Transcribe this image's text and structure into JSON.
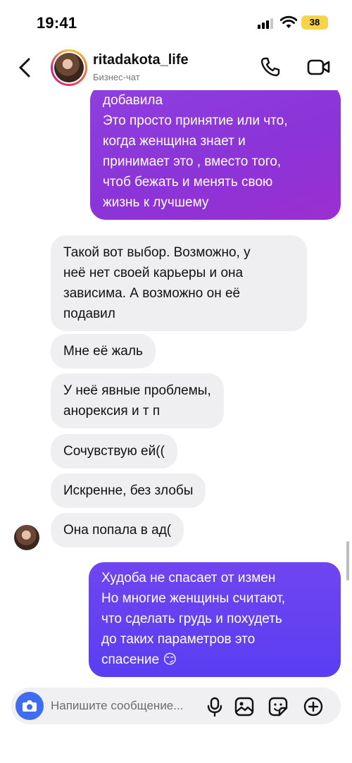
{
  "status_bar": {
    "time": "19:41",
    "battery": "38"
  },
  "header": {
    "username": "ritadakota_life",
    "subtitle": "Бизнес-чат"
  },
  "messages": [
    {
      "direction": "outgoing",
      "lines": [
        "добавила",
        "Это просто принятие или что,",
        "когда женщина знает и",
        "принимает это , вместо того,",
        "чтоб бежать и менять свою",
        "жизнь к лучшему"
      ]
    },
    {
      "direction": "incoming",
      "lines": [
        "Такой вот выбор. Возможно, у",
        "неё нет своей карьеры и она",
        "зависима. А возможно он её",
        "подавил"
      ]
    },
    {
      "direction": "incoming",
      "lines": [
        "Мне её жаль"
      ]
    },
    {
      "direction": "incoming",
      "lines": [
        "У неё явные проблемы,",
        "анорексия и т п"
      ]
    },
    {
      "direction": "incoming",
      "lines": [
        "Сочувствую ей(("
      ]
    },
    {
      "direction": "incoming",
      "lines": [
        "Искренне, без злобы"
      ]
    },
    {
      "direction": "incoming",
      "lines": [
        "Она попала в ад("
      ]
    },
    {
      "direction": "outgoing",
      "lines": [
        "Худоба не спасает от измен",
        "Но многие женщины считают,",
        "что сделать грудь и похудеть",
        "до таких параметров это",
        "спасение"
      ],
      "emoji": "😏"
    }
  ],
  "composer": {
    "placeholder": "Напишите сообщение..."
  },
  "colors": {
    "outgoing_purple": "#8b34d8",
    "outgoing_violet": "#5a3ef2",
    "incoming": "#efeff1",
    "camera": "#3f6df2"
  }
}
